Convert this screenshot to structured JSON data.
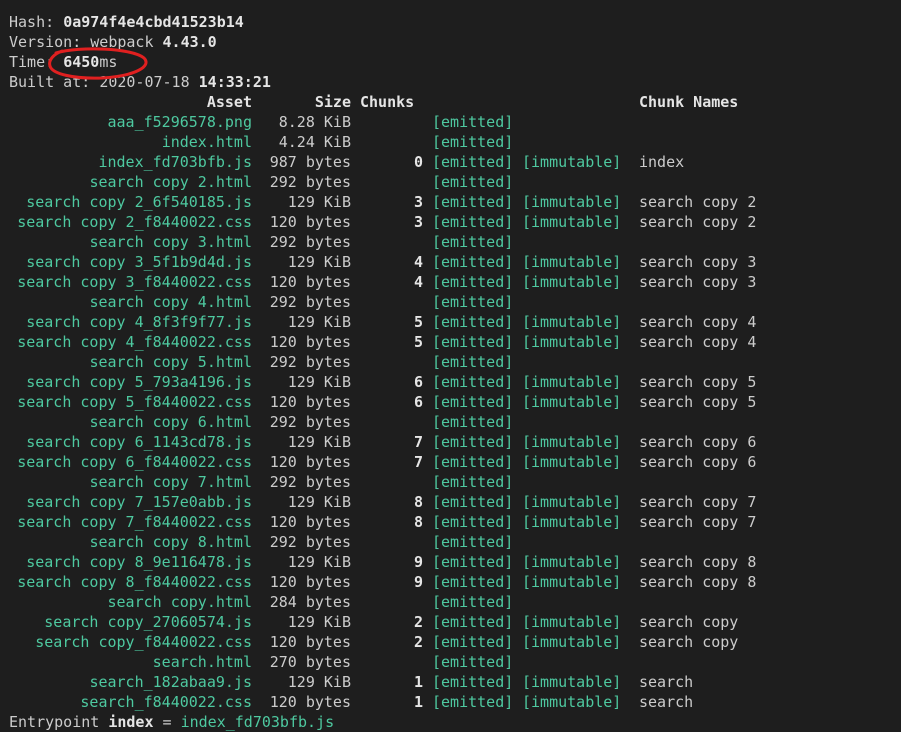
{
  "meta": {
    "hash_label": "Hash: ",
    "hash_value": "0a974f4e4cbd41523b14",
    "version_label": "Version: webpack ",
    "version_value": "4.43.0",
    "time_label": "Time: ",
    "time_value": "6450",
    "time_unit": "ms",
    "built_label": "Built at: ",
    "built_date": "2020-07-18 ",
    "built_time": "14:33:21"
  },
  "table": {
    "headers": {
      "asset": "Asset",
      "size": "Size",
      "chunks": "Chunks",
      "chunk_names": "Chunk Names"
    },
    "rows": [
      {
        "asset": "aaa_f5296578.png",
        "size": "8.28 KiB",
        "chunk": "",
        "emitted": "[emitted]",
        "immutable": "",
        "name": ""
      },
      {
        "asset": "index.html",
        "size": "4.24 KiB",
        "chunk": "",
        "emitted": "[emitted]",
        "immutable": "",
        "name": ""
      },
      {
        "asset": "index_fd703bfb.js",
        "size": "987 bytes",
        "chunk": "0",
        "emitted": "[emitted]",
        "immutable": "[immutable]",
        "name": "index"
      },
      {
        "asset": "search copy 2.html",
        "size": "292 bytes",
        "chunk": "",
        "emitted": "[emitted]",
        "immutable": "",
        "name": ""
      },
      {
        "asset": "search copy 2_6f540185.js",
        "size": "129 KiB",
        "chunk": "3",
        "emitted": "[emitted]",
        "immutable": "[immutable]",
        "name": "search copy 2"
      },
      {
        "asset": "search copy 2_f8440022.css",
        "size": "120 bytes",
        "chunk": "3",
        "emitted": "[emitted]",
        "immutable": "[immutable]",
        "name": "search copy 2"
      },
      {
        "asset": "search copy 3.html",
        "size": "292 bytes",
        "chunk": "",
        "emitted": "[emitted]",
        "immutable": "",
        "name": ""
      },
      {
        "asset": "search copy 3_5f1b9d4d.js",
        "size": "129 KiB",
        "chunk": "4",
        "emitted": "[emitted]",
        "immutable": "[immutable]",
        "name": "search copy 3"
      },
      {
        "asset": "search copy 3_f8440022.css",
        "size": "120 bytes",
        "chunk": "4",
        "emitted": "[emitted]",
        "immutable": "[immutable]",
        "name": "search copy 3"
      },
      {
        "asset": "search copy 4.html",
        "size": "292 bytes",
        "chunk": "",
        "emitted": "[emitted]",
        "immutable": "",
        "name": ""
      },
      {
        "asset": "search copy 4_8f3f9f77.js",
        "size": "129 KiB",
        "chunk": "5",
        "emitted": "[emitted]",
        "immutable": "[immutable]",
        "name": "search copy 4"
      },
      {
        "asset": "search copy 4_f8440022.css",
        "size": "120 bytes",
        "chunk": "5",
        "emitted": "[emitted]",
        "immutable": "[immutable]",
        "name": "search copy 4"
      },
      {
        "asset": "search copy 5.html",
        "size": "292 bytes",
        "chunk": "",
        "emitted": "[emitted]",
        "immutable": "",
        "name": ""
      },
      {
        "asset": "search copy 5_793a4196.js",
        "size": "129 KiB",
        "chunk": "6",
        "emitted": "[emitted]",
        "immutable": "[immutable]",
        "name": "search copy 5"
      },
      {
        "asset": "search copy 5_f8440022.css",
        "size": "120 bytes",
        "chunk": "6",
        "emitted": "[emitted]",
        "immutable": "[immutable]",
        "name": "search copy 5"
      },
      {
        "asset": "search copy 6.html",
        "size": "292 bytes",
        "chunk": "",
        "emitted": "[emitted]",
        "immutable": "",
        "name": ""
      },
      {
        "asset": "search copy 6_1143cd78.js",
        "size": "129 KiB",
        "chunk": "7",
        "emitted": "[emitted]",
        "immutable": "[immutable]",
        "name": "search copy 6"
      },
      {
        "asset": "search copy 6_f8440022.css",
        "size": "120 bytes",
        "chunk": "7",
        "emitted": "[emitted]",
        "immutable": "[immutable]",
        "name": "search copy 6"
      },
      {
        "asset": "search copy 7.html",
        "size": "292 bytes",
        "chunk": "",
        "emitted": "[emitted]",
        "immutable": "",
        "name": ""
      },
      {
        "asset": "search copy 7_157e0abb.js",
        "size": "129 KiB",
        "chunk": "8",
        "emitted": "[emitted]",
        "immutable": "[immutable]",
        "name": "search copy 7"
      },
      {
        "asset": "search copy 7_f8440022.css",
        "size": "120 bytes",
        "chunk": "8",
        "emitted": "[emitted]",
        "immutable": "[immutable]",
        "name": "search copy 7"
      },
      {
        "asset": "search copy 8.html",
        "size": "292 bytes",
        "chunk": "",
        "emitted": "[emitted]",
        "immutable": "",
        "name": ""
      },
      {
        "asset": "search copy 8_9e116478.js",
        "size": "129 KiB",
        "chunk": "9",
        "emitted": "[emitted]",
        "immutable": "[immutable]",
        "name": "search copy 8"
      },
      {
        "asset": "search copy 8_f8440022.css",
        "size": "120 bytes",
        "chunk": "9",
        "emitted": "[emitted]",
        "immutable": "[immutable]",
        "name": "search copy 8"
      },
      {
        "asset": "search copy.html",
        "size": "284 bytes",
        "chunk": "",
        "emitted": "[emitted]",
        "immutable": "",
        "name": ""
      },
      {
        "asset": "search copy_27060574.js",
        "size": "129 KiB",
        "chunk": "2",
        "emitted": "[emitted]",
        "immutable": "[immutable]",
        "name": "search copy"
      },
      {
        "asset": "search copy_f8440022.css",
        "size": "120 bytes",
        "chunk": "2",
        "emitted": "[emitted]",
        "immutable": "[immutable]",
        "name": "search copy"
      },
      {
        "asset": "search.html",
        "size": "270 bytes",
        "chunk": "",
        "emitted": "[emitted]",
        "immutable": "",
        "name": ""
      },
      {
        "asset": "search_182abaa9.js",
        "size": "129 KiB",
        "chunk": "1",
        "emitted": "[emitted]",
        "immutable": "[immutable]",
        "name": "search"
      },
      {
        "asset": "search_f8440022.css",
        "size": "120 bytes",
        "chunk": "1",
        "emitted": "[emitted]",
        "immutable": "[immutable]",
        "name": "search"
      }
    ]
  },
  "entrypoint": {
    "label": "Entrypoint ",
    "name": "index",
    "separator": " = ",
    "file": "index_fd703bfb.js"
  },
  "colors": {
    "background": "#1e1e1e",
    "text": "#cccccc",
    "bold_text": "#e5e5e5",
    "green": "#4ec9a0",
    "annotation_red": "#e02020"
  }
}
